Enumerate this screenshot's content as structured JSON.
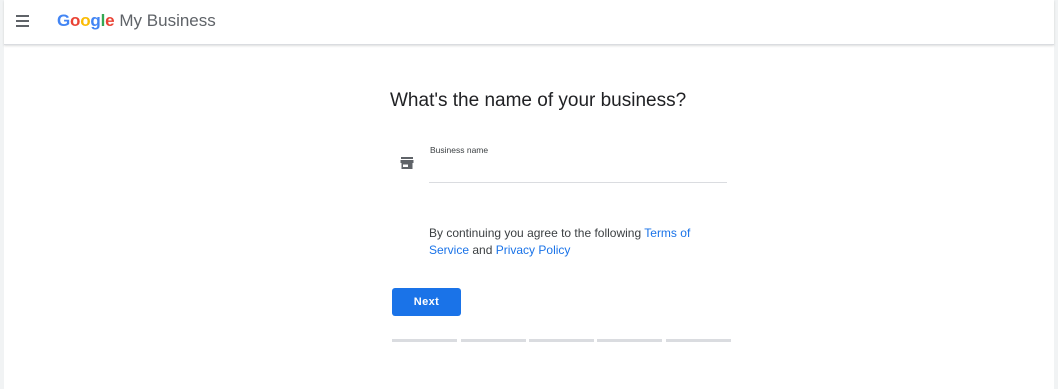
{
  "header": {
    "menu_icon": "hamburger-menu-icon",
    "brand": {
      "letters": [
        "G",
        "o",
        "o",
        "g",
        "l",
        "e"
      ],
      "product": "My Business"
    }
  },
  "main": {
    "title": "What's the name of your business?",
    "field": {
      "icon": "storefront-icon",
      "label": "Business name",
      "value": ""
    },
    "consent": {
      "prefix": "By continuing you agree to the following ",
      "terms_link": "Terms of Service",
      "middle": " and ",
      "privacy_link": "Privacy Policy"
    },
    "next_label": "Next",
    "progress": {
      "total_steps": 5,
      "completed_steps": 0
    }
  },
  "colors": {
    "accent": "#1a73e8",
    "progress_track": "#dadce0",
    "google_blue": "#4285f4",
    "google_red": "#ea4335",
    "google_yellow": "#fbbc05",
    "google_green": "#34a853"
  }
}
